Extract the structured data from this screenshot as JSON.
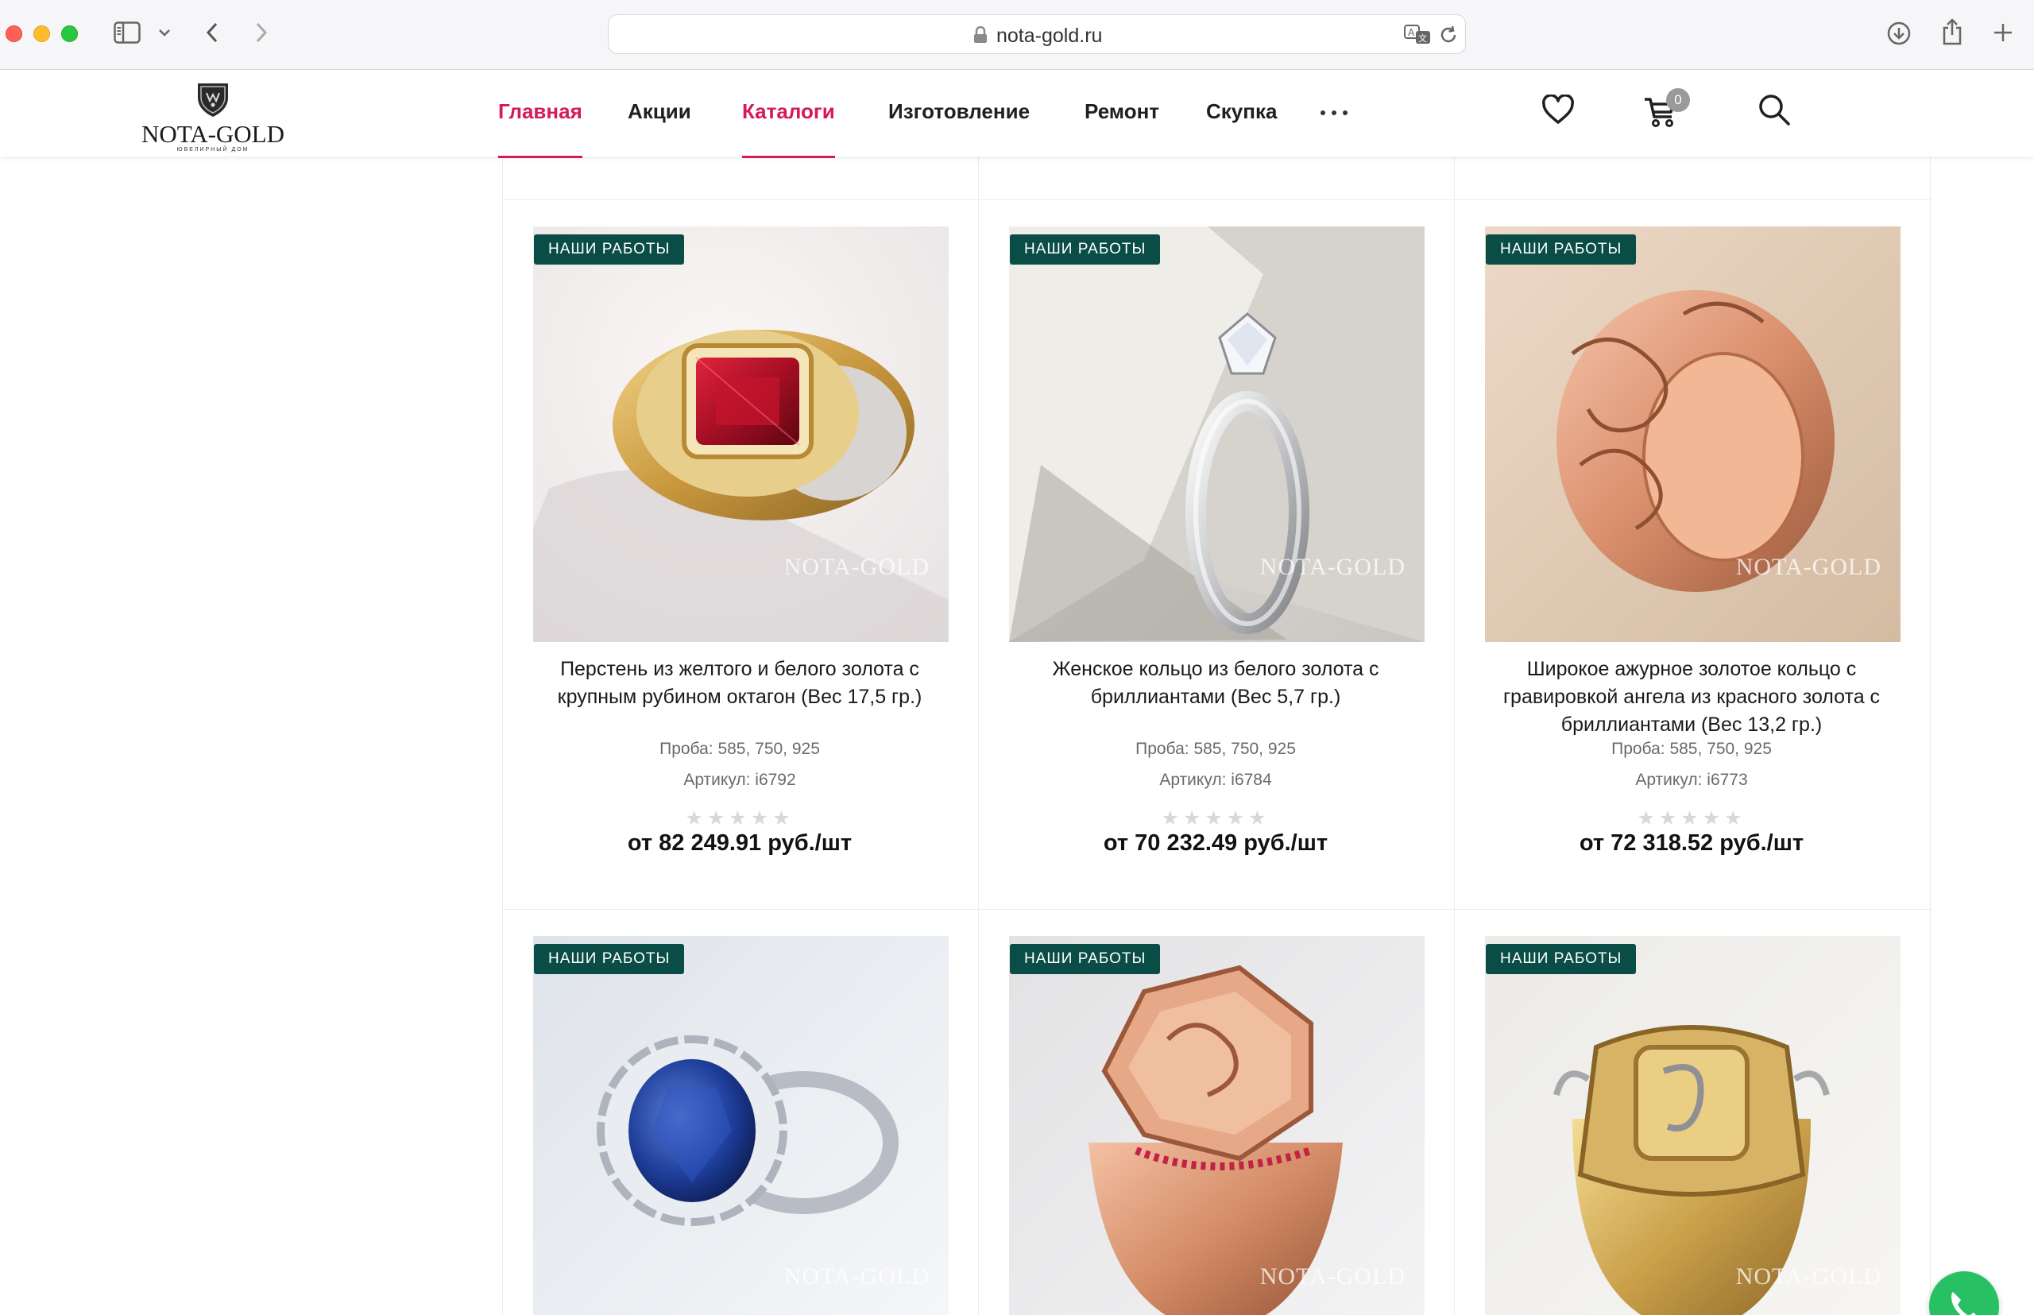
{
  "browser": {
    "url": "nota-gold.ru"
  },
  "header": {
    "logo": {
      "brand": "NOTA-GOLD",
      "tagline": "ЮВЕЛИРНЫЙ ДОМ"
    },
    "nav": [
      {
        "label": "Главная",
        "active": true
      },
      {
        "label": "Акции",
        "active": false
      },
      {
        "label": "Каталоги",
        "active": true
      },
      {
        "label": "Изготовление",
        "active": false
      },
      {
        "label": "Ремонт",
        "active": false
      },
      {
        "label": "Скупка",
        "active": false
      }
    ],
    "cart_count": "0",
    "accent_color": "#d6185d"
  },
  "products": [
    {
      "badge": "НАШИ РАБОТЫ",
      "watermark": "NOTA-GOLD",
      "title": "Перстень из желтого и белого золота с крупным рубином октагон (Вес 17,5 гр.)",
      "proba": "Проба: 585, 750, 925",
      "article": "Артикул: i6792",
      "rating": 0,
      "price": "от 82 249.91 руб./шт"
    },
    {
      "badge": "НАШИ РАБОТЫ",
      "watermark": "NOTA-GOLD",
      "title": "Женское кольцо из белого золота с бриллиантами (Вес 5,7 гр.)",
      "proba": "Проба: 585, 750, 925",
      "article": "Артикул: i6784",
      "rating": 0,
      "price": "от 70 232.49 руб./шт"
    },
    {
      "badge": "НАШИ РАБОТЫ",
      "watermark": "NOTA-GOLD",
      "title": "Широкое ажурное золотое кольцо с гравировкой ангела из красного золота с бриллиантами (Вес 13,2 гр.)",
      "proba": "Проба: 585, 750, 925",
      "article": "Артикул: i6773",
      "rating": 0,
      "price": "от 72 318.52 руб./шт"
    },
    {
      "badge": "НАШИ РАБОТЫ",
      "watermark": "NOTA-GOLD"
    },
    {
      "badge": "НАШИ РАБОТЫ",
      "watermark": "NOTA-GOLD"
    },
    {
      "badge": "НАШИ РАБОТЫ",
      "watermark": "NOTA-GOLD"
    }
  ],
  "colors": {
    "badge_bg": "#0a4d46",
    "chat_button": "#27c164"
  }
}
